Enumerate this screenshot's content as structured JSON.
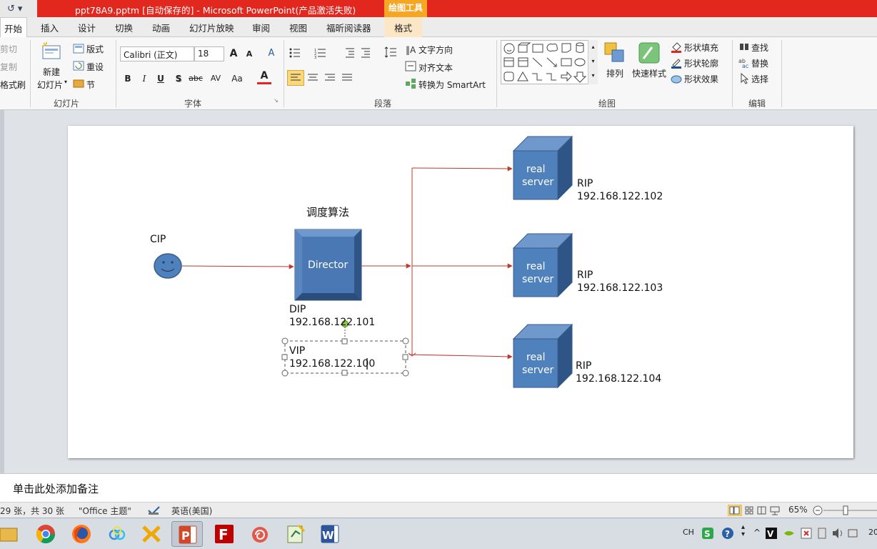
{
  "title_bar": {
    "qat_undo": "↺",
    "qat_more": "▾",
    "title": "ppt78A9.pptm [自动保存的]  -  Microsoft PowerPoint(产品激活失败)",
    "contextual_group": "绘图工具"
  },
  "tabs": [
    "开始",
    "插入",
    "设计",
    "切换",
    "动画",
    "幻灯片放映",
    "审阅",
    "视图",
    "福昕阅读器",
    "格式"
  ],
  "ribbon": {
    "clipboard": {
      "cut": "剪切",
      "copy": "复制",
      "format_painter": "格式刷"
    },
    "slides": {
      "new_slide_1": "新建",
      "new_slide_2": "幻灯片",
      "layout": "版式",
      "reset": "重设",
      "section": "节",
      "group": "幻灯片"
    },
    "font": {
      "family": "Calibri (正文)",
      "size": "18",
      "grow": "A",
      "shrink": "A",
      "clear": "A",
      "bold": "B",
      "italic": "I",
      "underline": "U",
      "shadow": "S",
      "strike": "abc",
      "spacing": "AV",
      "case": "Aa",
      "color": "A",
      "group": "字体"
    },
    "paragraph": {
      "text_direction": "文字方向",
      "align_text": "对齐文本",
      "smartart": "转换为 SmartArt",
      "group": "段落"
    },
    "drawing": {
      "arrange": "排列",
      "quick_styles": "快速样式",
      "shape_fill": "形状填充",
      "shape_outline": "形状轮廓",
      "shape_effects": "形状效果",
      "group": "绘图"
    },
    "editing": {
      "find": "查找",
      "replace": "替换",
      "select": "选择",
      "group": "编辑"
    }
  },
  "slide": {
    "cip_label": "CIP",
    "scheduler_label": "调度算法",
    "director_label": "Director",
    "dip_label": "DIP",
    "dip_value": "192.168.122.101",
    "vip_label": "VIP",
    "vip_value": "192.168.122.100",
    "servers": [
      {
        "name_1": "real",
        "name_2": "server",
        "rip_label": "RIP",
        "rip_value": "192.168.122.102"
      },
      {
        "name_1": "real",
        "name_2": "server",
        "rip_label": "RIP",
        "rip_value": "192.168.122.103"
      },
      {
        "name_1": "real",
        "name_2": "server",
        "rip_label": "RIP",
        "rip_value": "192.168.122.104"
      }
    ]
  },
  "notes": {
    "placeholder": "单击此处添加备注"
  },
  "status_bar": {
    "slide_count": "29 张，共 30 张",
    "theme": "\"Office 主题\"",
    "language": "英语(美国)",
    "zoom": "65%"
  },
  "taskbar": {
    "apps": [
      "chrome",
      "firefox",
      "baidu-netdisk",
      "xmind",
      "powerpoint",
      "filezilla",
      "snail",
      "notepad",
      "word"
    ],
    "tray_lang": "CH",
    "clock_partial": "20"
  },
  "colors": {
    "title_red": "#e2271e",
    "accent_orange": "#f5a623",
    "shape_blue": "#4f81bd",
    "shape_border": "#385d8a",
    "arrow_red": "#c0392b"
  }
}
